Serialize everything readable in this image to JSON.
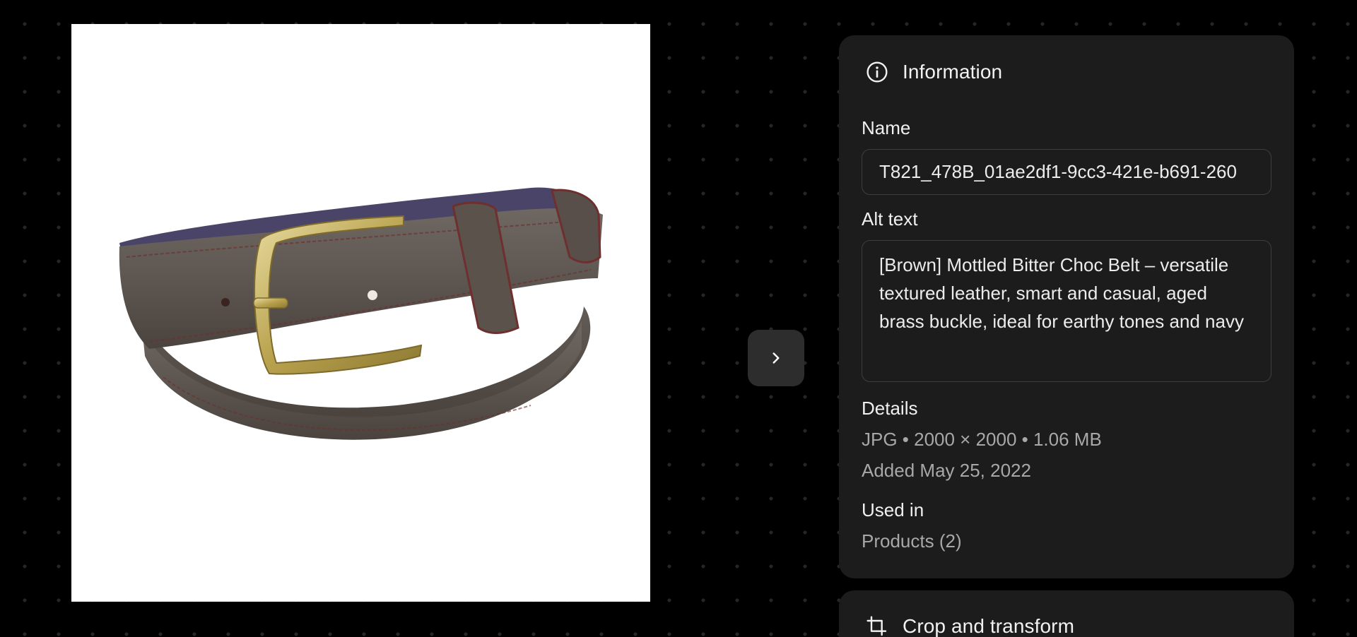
{
  "preview": {
    "image_alt": "Brown textured leather belt with brass buckle"
  },
  "navigation": {
    "next_icon": "chevron-right-icon"
  },
  "info_panel": {
    "title": "Information",
    "icon": "info-icon",
    "name_label": "Name",
    "name_value": "T821_478B_01ae2df1-9cc3-421e-b691-260",
    "alt_label": "Alt text",
    "alt_value": "[Brown] Mottled Bitter Choc Belt – versatile textured leather, smart and casual, aged brass buckle, ideal for earthy tones and navy",
    "details_label": "Details",
    "details_line": "JPG • 2000 × 2000 • 1.06 MB",
    "added_line": "Added May 25, 2022",
    "used_in_label": "Used in",
    "used_in_value": "Products (2)"
  },
  "crop_panel": {
    "title": "Crop and transform",
    "icon": "crop-icon"
  },
  "colors": {
    "background": "#000000",
    "panel": "#1c1c1c",
    "field_border": "#3e3e3e",
    "muted_text": "#a8a8a8",
    "button": "#2d2d2d"
  }
}
